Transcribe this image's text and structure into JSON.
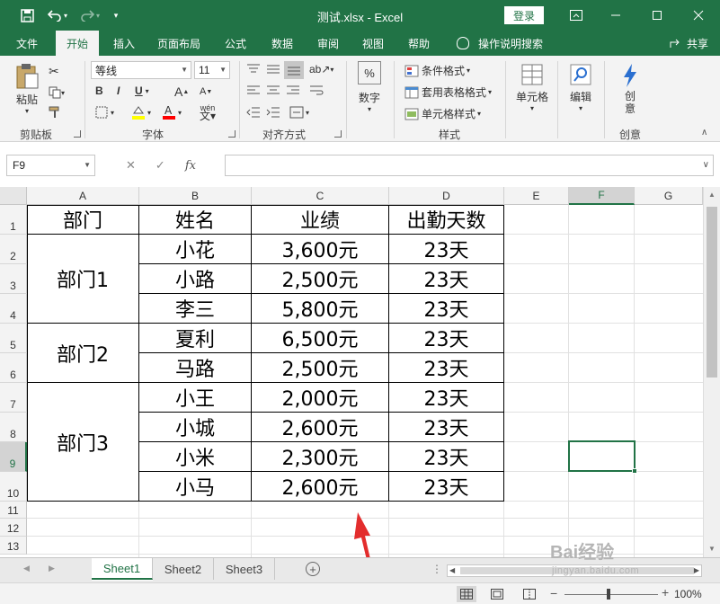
{
  "titlebar": {
    "title": "测试.xlsx  -  Excel",
    "login_label": "登录",
    "icons": [
      "save-icon",
      "undo-icon",
      "redo-icon",
      "customize-icon"
    ]
  },
  "ribbon_tabs": [
    "文件",
    "开始",
    "插入",
    "页面布局",
    "公式",
    "数据",
    "审阅",
    "视图",
    "帮助"
  ],
  "active_tab": "开始",
  "tell_me": "操作说明搜索",
  "share": "共享",
  "ribbon": {
    "clipboard": {
      "paste": "粘贴",
      "group": "剪贴板"
    },
    "font": {
      "name": "等线",
      "size": "11",
      "group": "字体",
      "bold": "B",
      "italic": "I",
      "underline": "U",
      "grow": "A",
      "shrink": "A",
      "phonetic": "wén"
    },
    "alignment": {
      "group": "对齐方式"
    },
    "number": {
      "label": "数字",
      "symbol": "%"
    },
    "styles": {
      "conditional": "条件格式",
      "table": "套用表格格式",
      "cell": "单元格样式",
      "group": "样式"
    },
    "cells": {
      "label": "单元格"
    },
    "editing": {
      "label": "编辑"
    },
    "creative": {
      "label": "创\n意",
      "group": "创意"
    }
  },
  "name_box": "F9",
  "formula": "",
  "columns": [
    "A",
    "B",
    "C",
    "D",
    "E",
    "F",
    "G"
  ],
  "rows": [
    "1",
    "2",
    "3",
    "4",
    "5",
    "6",
    "7",
    "8",
    "9",
    "10",
    "11",
    "12",
    "13"
  ],
  "selected": {
    "col": "F",
    "row": "9"
  },
  "table": {
    "headers": [
      "部门",
      "姓名",
      "业绩",
      "出勤天数"
    ],
    "departments": [
      "部门1",
      "部门2",
      "部门3"
    ],
    "names": [
      "小花",
      "小路",
      "李三",
      "夏利",
      "马路",
      "小王",
      "小城",
      "小米",
      "小马"
    ],
    "sales": [
      "3,600元",
      "2,500元",
      "5,800元",
      "6,500元",
      "2,500元",
      "2,000元",
      "2,600元",
      "2,300元",
      "2,600元"
    ],
    "attendance": [
      "23天",
      "23天",
      "23天",
      "23天",
      "23天",
      "23天",
      "23天",
      "23天",
      "23天"
    ]
  },
  "sheets": [
    "Sheet1",
    "Sheet2",
    "Sheet3"
  ],
  "active_sheet": "Sheet1",
  "status": {
    "zoom": "100%"
  },
  "watermark": {
    "brand": "Bai经验",
    "url": "jingyan.baidu.com"
  },
  "colors": {
    "accent": "#217346",
    "annotation": "#e32d2d"
  }
}
